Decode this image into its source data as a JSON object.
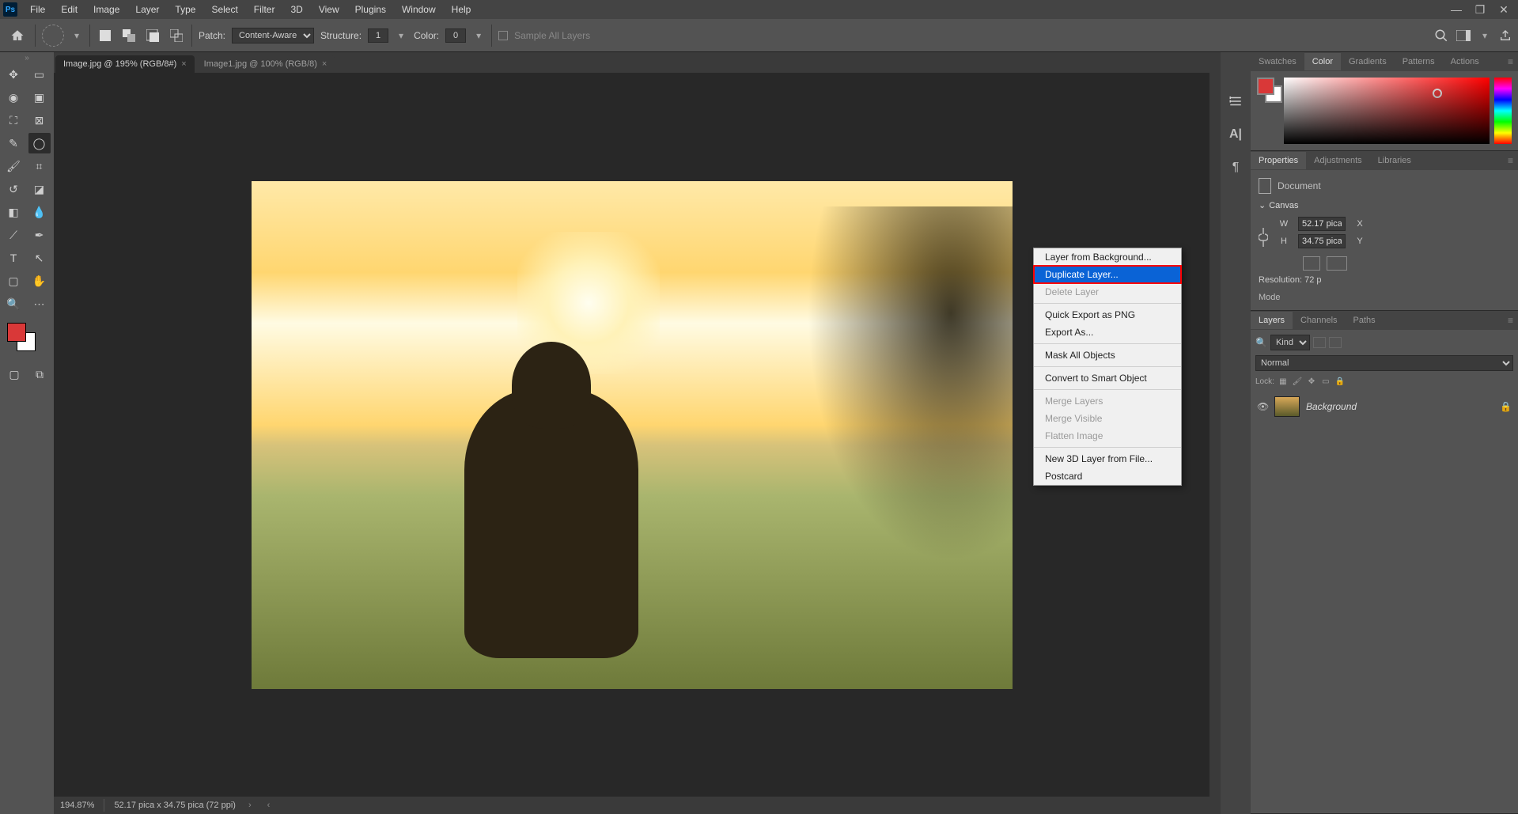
{
  "menubar": {
    "items": [
      "File",
      "Edit",
      "Image",
      "Layer",
      "Type",
      "Select",
      "Filter",
      "3D",
      "View",
      "Plugins",
      "Window",
      "Help"
    ]
  },
  "options": {
    "patch_label": "Patch:",
    "patch_mode": "Content-Aware",
    "structure_label": "Structure:",
    "structure_value": "1",
    "color_label": "Color:",
    "color_value": "0",
    "sample_all_label": "Sample All Layers"
  },
  "doc_tabs": [
    {
      "label": "Image.jpg @ 195% (RGB/8#)",
      "active": true
    },
    {
      "label": "Image1.jpg @ 100% (RGB/8)",
      "active": false
    }
  ],
  "status": {
    "zoom": "194.87%",
    "info": "52.17 pica x 34.75 pica (72 ppi)"
  },
  "panels": {
    "color_tabs": [
      "Swatches",
      "Color",
      "Gradients",
      "Patterns",
      "Actions"
    ],
    "color_active": "Color",
    "properties_tabs": [
      "Properties",
      "Adjustments",
      "Libraries"
    ],
    "properties_active": "Properties",
    "layers_tabs": [
      "Layers",
      "Channels",
      "Paths"
    ],
    "layers_active": "Layers"
  },
  "properties": {
    "document_label": "Document",
    "canvas_label": "Canvas",
    "w_label": "W",
    "w_value": "52.17 pica",
    "h_label": "H",
    "h_value": "34.75 pica",
    "x_label": "X",
    "y_label": "Y",
    "resolution_label": "Resolution:",
    "resolution_value": "72 p",
    "mode_label": "Mode"
  },
  "layers": {
    "filter_kind": "Kind",
    "blend_mode": "Normal",
    "lock_label": "Lock:",
    "layer_name": "Background"
  },
  "context_menu": {
    "items": [
      {
        "label": "Layer from Background...",
        "disabled": false
      },
      {
        "label": "Duplicate Layer...",
        "disabled": false,
        "highlighted": true
      },
      {
        "label": "Delete Layer",
        "disabled": true
      },
      {
        "sep": true
      },
      {
        "label": "Quick Export as PNG",
        "disabled": false
      },
      {
        "label": "Export As...",
        "disabled": false
      },
      {
        "sep": true
      },
      {
        "label": "Mask All Objects",
        "disabled": false
      },
      {
        "sep": true
      },
      {
        "label": "Convert to Smart Object",
        "disabled": false
      },
      {
        "sep": true
      },
      {
        "label": "Merge Layers",
        "disabled": true
      },
      {
        "label": "Merge Visible",
        "disabled": true
      },
      {
        "label": "Flatten Image",
        "disabled": true
      },
      {
        "sep": true
      },
      {
        "label": "New 3D Layer from File...",
        "disabled": false
      },
      {
        "label": "Postcard",
        "disabled": false
      }
    ]
  }
}
